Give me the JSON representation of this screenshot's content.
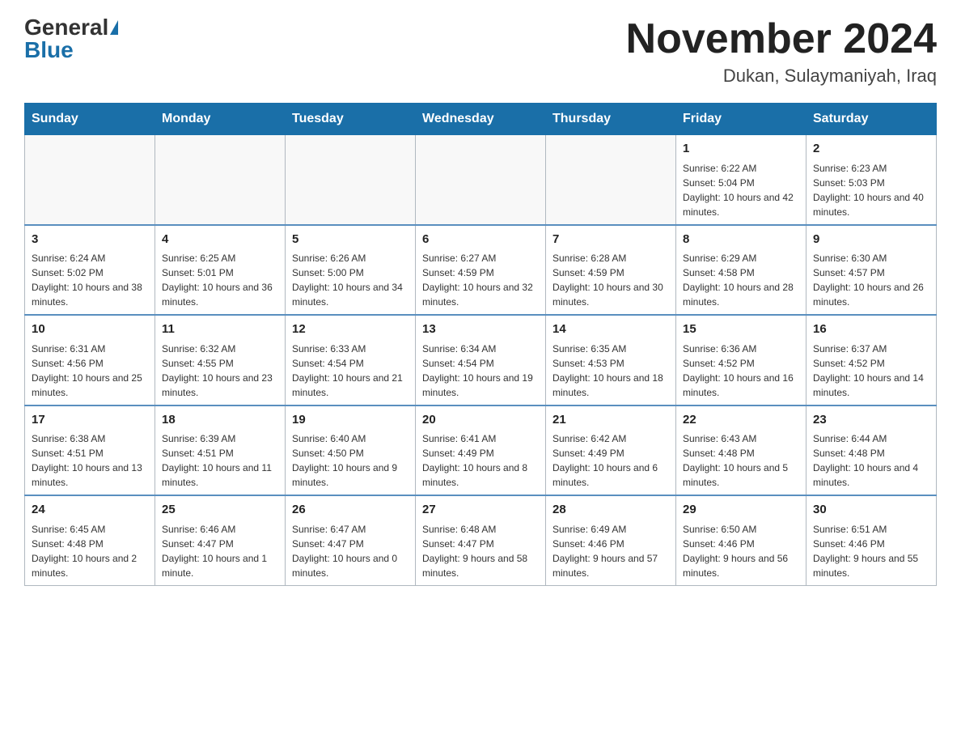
{
  "header": {
    "logo_general": "General",
    "logo_blue": "Blue",
    "month_title": "November 2024",
    "location": "Dukan, Sulaymaniyah, Iraq"
  },
  "days_of_week": [
    "Sunday",
    "Monday",
    "Tuesday",
    "Wednesday",
    "Thursday",
    "Friday",
    "Saturday"
  ],
  "weeks": [
    [
      {
        "day": "",
        "sunrise": "",
        "sunset": "",
        "daylight": ""
      },
      {
        "day": "",
        "sunrise": "",
        "sunset": "",
        "daylight": ""
      },
      {
        "day": "",
        "sunrise": "",
        "sunset": "",
        "daylight": ""
      },
      {
        "day": "",
        "sunrise": "",
        "sunset": "",
        "daylight": ""
      },
      {
        "day": "",
        "sunrise": "",
        "sunset": "",
        "daylight": ""
      },
      {
        "day": "1",
        "sunrise": "Sunrise: 6:22 AM",
        "sunset": "Sunset: 5:04 PM",
        "daylight": "Daylight: 10 hours and 42 minutes."
      },
      {
        "day": "2",
        "sunrise": "Sunrise: 6:23 AM",
        "sunset": "Sunset: 5:03 PM",
        "daylight": "Daylight: 10 hours and 40 minutes."
      }
    ],
    [
      {
        "day": "3",
        "sunrise": "Sunrise: 6:24 AM",
        "sunset": "Sunset: 5:02 PM",
        "daylight": "Daylight: 10 hours and 38 minutes."
      },
      {
        "day": "4",
        "sunrise": "Sunrise: 6:25 AM",
        "sunset": "Sunset: 5:01 PM",
        "daylight": "Daylight: 10 hours and 36 minutes."
      },
      {
        "day": "5",
        "sunrise": "Sunrise: 6:26 AM",
        "sunset": "Sunset: 5:00 PM",
        "daylight": "Daylight: 10 hours and 34 minutes."
      },
      {
        "day": "6",
        "sunrise": "Sunrise: 6:27 AM",
        "sunset": "Sunset: 4:59 PM",
        "daylight": "Daylight: 10 hours and 32 minutes."
      },
      {
        "day": "7",
        "sunrise": "Sunrise: 6:28 AM",
        "sunset": "Sunset: 4:59 PM",
        "daylight": "Daylight: 10 hours and 30 minutes."
      },
      {
        "day": "8",
        "sunrise": "Sunrise: 6:29 AM",
        "sunset": "Sunset: 4:58 PM",
        "daylight": "Daylight: 10 hours and 28 minutes."
      },
      {
        "day": "9",
        "sunrise": "Sunrise: 6:30 AM",
        "sunset": "Sunset: 4:57 PM",
        "daylight": "Daylight: 10 hours and 26 minutes."
      }
    ],
    [
      {
        "day": "10",
        "sunrise": "Sunrise: 6:31 AM",
        "sunset": "Sunset: 4:56 PM",
        "daylight": "Daylight: 10 hours and 25 minutes."
      },
      {
        "day": "11",
        "sunrise": "Sunrise: 6:32 AM",
        "sunset": "Sunset: 4:55 PM",
        "daylight": "Daylight: 10 hours and 23 minutes."
      },
      {
        "day": "12",
        "sunrise": "Sunrise: 6:33 AM",
        "sunset": "Sunset: 4:54 PM",
        "daylight": "Daylight: 10 hours and 21 minutes."
      },
      {
        "day": "13",
        "sunrise": "Sunrise: 6:34 AM",
        "sunset": "Sunset: 4:54 PM",
        "daylight": "Daylight: 10 hours and 19 minutes."
      },
      {
        "day": "14",
        "sunrise": "Sunrise: 6:35 AM",
        "sunset": "Sunset: 4:53 PM",
        "daylight": "Daylight: 10 hours and 18 minutes."
      },
      {
        "day": "15",
        "sunrise": "Sunrise: 6:36 AM",
        "sunset": "Sunset: 4:52 PM",
        "daylight": "Daylight: 10 hours and 16 minutes."
      },
      {
        "day": "16",
        "sunrise": "Sunrise: 6:37 AM",
        "sunset": "Sunset: 4:52 PM",
        "daylight": "Daylight: 10 hours and 14 minutes."
      }
    ],
    [
      {
        "day": "17",
        "sunrise": "Sunrise: 6:38 AM",
        "sunset": "Sunset: 4:51 PM",
        "daylight": "Daylight: 10 hours and 13 minutes."
      },
      {
        "day": "18",
        "sunrise": "Sunrise: 6:39 AM",
        "sunset": "Sunset: 4:51 PM",
        "daylight": "Daylight: 10 hours and 11 minutes."
      },
      {
        "day": "19",
        "sunrise": "Sunrise: 6:40 AM",
        "sunset": "Sunset: 4:50 PM",
        "daylight": "Daylight: 10 hours and 9 minutes."
      },
      {
        "day": "20",
        "sunrise": "Sunrise: 6:41 AM",
        "sunset": "Sunset: 4:49 PM",
        "daylight": "Daylight: 10 hours and 8 minutes."
      },
      {
        "day": "21",
        "sunrise": "Sunrise: 6:42 AM",
        "sunset": "Sunset: 4:49 PM",
        "daylight": "Daylight: 10 hours and 6 minutes."
      },
      {
        "day": "22",
        "sunrise": "Sunrise: 6:43 AM",
        "sunset": "Sunset: 4:48 PM",
        "daylight": "Daylight: 10 hours and 5 minutes."
      },
      {
        "day": "23",
        "sunrise": "Sunrise: 6:44 AM",
        "sunset": "Sunset: 4:48 PM",
        "daylight": "Daylight: 10 hours and 4 minutes."
      }
    ],
    [
      {
        "day": "24",
        "sunrise": "Sunrise: 6:45 AM",
        "sunset": "Sunset: 4:48 PM",
        "daylight": "Daylight: 10 hours and 2 minutes."
      },
      {
        "day": "25",
        "sunrise": "Sunrise: 6:46 AM",
        "sunset": "Sunset: 4:47 PM",
        "daylight": "Daylight: 10 hours and 1 minute."
      },
      {
        "day": "26",
        "sunrise": "Sunrise: 6:47 AM",
        "sunset": "Sunset: 4:47 PM",
        "daylight": "Daylight: 10 hours and 0 minutes."
      },
      {
        "day": "27",
        "sunrise": "Sunrise: 6:48 AM",
        "sunset": "Sunset: 4:47 PM",
        "daylight": "Daylight: 9 hours and 58 minutes."
      },
      {
        "day": "28",
        "sunrise": "Sunrise: 6:49 AM",
        "sunset": "Sunset: 4:46 PM",
        "daylight": "Daylight: 9 hours and 57 minutes."
      },
      {
        "day": "29",
        "sunrise": "Sunrise: 6:50 AM",
        "sunset": "Sunset: 4:46 PM",
        "daylight": "Daylight: 9 hours and 56 minutes."
      },
      {
        "day": "30",
        "sunrise": "Sunrise: 6:51 AM",
        "sunset": "Sunset: 4:46 PM",
        "daylight": "Daylight: 9 hours and 55 minutes."
      }
    ]
  ]
}
